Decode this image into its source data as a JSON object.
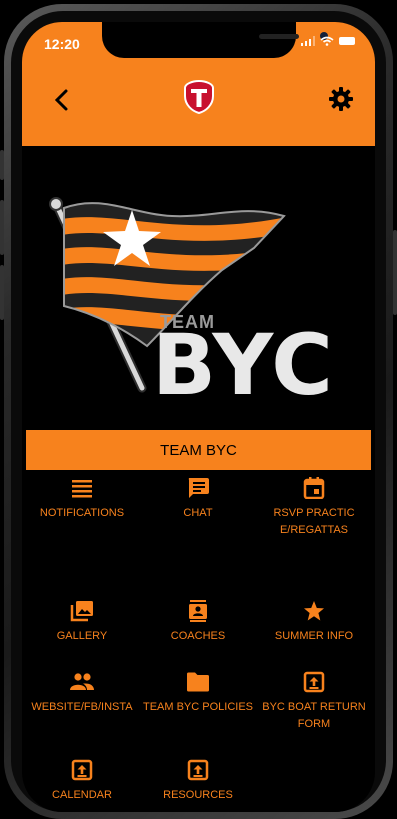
{
  "status_bar": {
    "time": "12:20"
  },
  "header": {
    "back_icon": "chevron-left-icon",
    "logo_icon": "team-shield-logo-icon",
    "settings_icon": "gear-icon"
  },
  "hero": {
    "team_word": "TEAM",
    "name_word": "BYC"
  },
  "section": {
    "title": "TEAM BYC"
  },
  "menu": [
    {
      "label": "NOTIFICATIONS",
      "icon": "list-icon"
    },
    {
      "label": "CHAT",
      "icon": "chat-icon"
    },
    {
      "label": "RSVP PRACTICE/REGATTAS",
      "icon": "calendar-icon"
    },
    {
      "label": "GALLERY",
      "icon": "gallery-icon"
    },
    {
      "label": "COACHES",
      "icon": "contact-card-icon"
    },
    {
      "label": "SUMMER INFO",
      "icon": "star-icon"
    },
    {
      "label": "WEBSITE/FB/INSTA",
      "icon": "people-icon"
    },
    {
      "label": "TEAM BYC POLICIES",
      "icon": "folder-icon"
    },
    {
      "label": "BYC BOAT RETURN FORM",
      "icon": "upload-icon"
    },
    {
      "label": "CALENDAR",
      "icon": "upload-icon"
    },
    {
      "label": "RESOURCES",
      "icon": "upload-icon"
    }
  ],
  "colors": {
    "accent": "#f7821d",
    "background": "#000000"
  }
}
